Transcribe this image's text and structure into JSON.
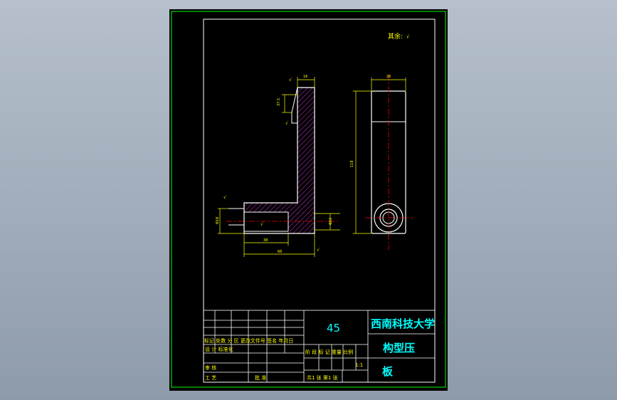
{
  "colors": {
    "background": "#9aa6b5",
    "sheet": "#000000",
    "frame": "#ffffff",
    "outer_border": "#00ff00",
    "outline": "#ffffff",
    "dimension": "#ffff00",
    "centerline": "#ff0000",
    "hatch": "#b030b0",
    "title_text": "#00ffff",
    "table_text": "#ffff00"
  },
  "drawing": {
    "roughness_note": "其余: ",
    "dims": {
      "top_width_side": "16",
      "notch_height": "37.5",
      "top_width_front": "26",
      "total_height": "118",
      "bore_dia_left": "Φ18",
      "bore_depth": "38",
      "base_length": "66",
      "bore_dia_right": "Φ22"
    }
  },
  "title_block": {
    "material": "45",
    "university": "西南科技大学",
    "part_name_line1": "构型压",
    "part_name_line2": "板",
    "header_row": "标记 处数 分 区 更改文件号 签名 年月日",
    "design_row": "设 计          标准化",
    "review_label": "审 核",
    "process_label": "工 艺",
    "approve_label": "批 准",
    "stage_headers": "阶 段 标 记  重量  比例",
    "scale": "1:1",
    "sheets": "共1 张    第1 张"
  }
}
